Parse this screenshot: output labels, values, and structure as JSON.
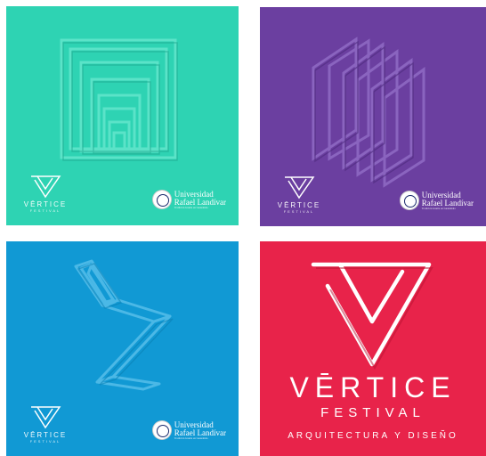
{
  "brand": {
    "wordmark": "VĒRTICE",
    "festival": "FESTIVAL",
    "tagline": "ARQUITECTURA Y DISEÑO"
  },
  "university": {
    "line1": "Universidad",
    "line2": "Rafael Landívar",
    "line3": "Tradición Jesuita en Guatemala"
  },
  "colors": {
    "teal": "#2ed3b3",
    "purple": "#6b3fa0",
    "blue": "#1199d4",
    "red": "#e8234a"
  },
  "panels": [
    {
      "art": "nested-squares",
      "color": "teal"
    },
    {
      "art": "stacked-parallelograms",
      "color": "purple"
    },
    {
      "art": "zigzag-chair",
      "color": "blue"
    },
    {
      "art": "triangle-logo",
      "color": "red"
    }
  ]
}
